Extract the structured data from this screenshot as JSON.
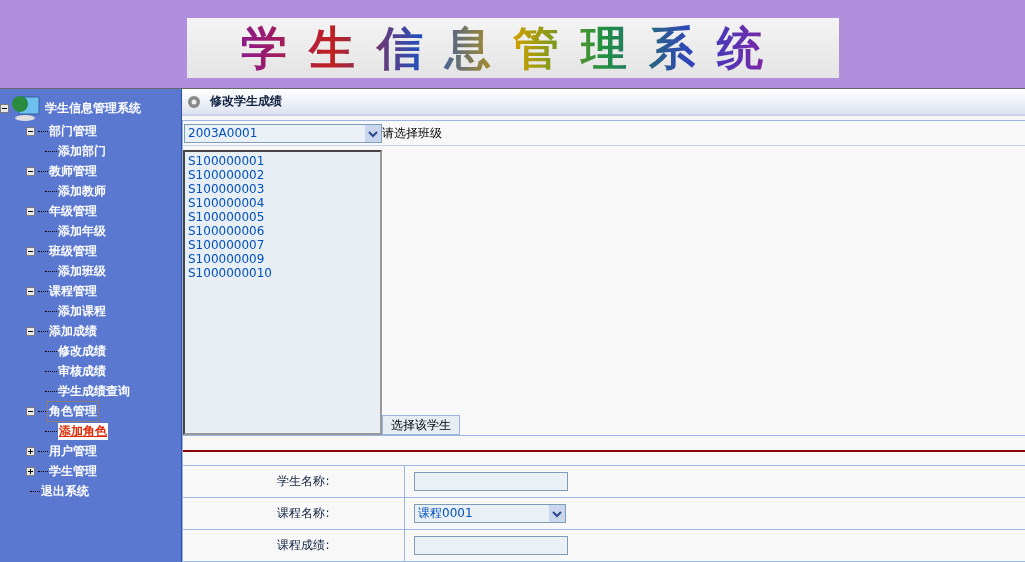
{
  "banner": {
    "title": "学生信息管理系统"
  },
  "sidebar": {
    "root": {
      "label": "学生信息管理系统",
      "expanded": true,
      "children": [
        {
          "kind": "group",
          "label": "部门管理",
          "expanded": true,
          "focused": false,
          "children": [
            {
              "label": "添加部门",
              "hovered": false
            }
          ]
        },
        {
          "kind": "group",
          "label": "教师管理",
          "expanded": true,
          "focused": false,
          "children": [
            {
              "label": "添加教师",
              "hovered": false
            }
          ]
        },
        {
          "kind": "group",
          "label": "年级管理",
          "expanded": true,
          "focused": false,
          "children": [
            {
              "label": "添加年级",
              "hovered": false
            }
          ]
        },
        {
          "kind": "group",
          "label": "班级管理",
          "expanded": true,
          "focused": false,
          "children": [
            {
              "label": "添加班级",
              "hovered": false
            }
          ]
        },
        {
          "kind": "group",
          "label": "课程管理",
          "expanded": true,
          "focused": false,
          "children": [
            {
              "label": "添加课程",
              "hovered": false
            }
          ]
        },
        {
          "kind": "group",
          "label": "添加成绩",
          "expanded": true,
          "focused": false,
          "children": [
            {
              "label": "修改成绩",
              "hovered": false
            },
            {
              "label": "审核成绩",
              "hovered": false
            },
            {
              "label": "学生成绩查询",
              "hovered": false
            }
          ]
        },
        {
          "kind": "group",
          "label": "角色管理",
          "expanded": true,
          "focused": true,
          "children": [
            {
              "label": "添加角色",
              "hovered": true
            }
          ]
        },
        {
          "kind": "group",
          "label": "用户管理",
          "expanded": false,
          "focused": false
        },
        {
          "kind": "group",
          "label": "学生管理",
          "expanded": false,
          "focused": false
        },
        {
          "kind": "link",
          "label": "退出系统"
        }
      ]
    }
  },
  "page": {
    "title": "修改学生成绩",
    "class_select": {
      "value": "2003A0001",
      "label": "请选择班级"
    },
    "students": [
      "S100000001",
      "S100000002",
      "S100000003",
      "S100000004",
      "S100000005",
      "S100000006",
      "S100000007",
      "S100000009",
      "S1000000010"
    ],
    "select_button": "选择该学生",
    "form": [
      {
        "kind": "text",
        "label": "学生名称:"
      },
      {
        "kind": "select",
        "label": "课程名称:",
        "value": "课程0001"
      },
      {
        "kind": "text",
        "label": "课程成绩:"
      }
    ]
  }
}
